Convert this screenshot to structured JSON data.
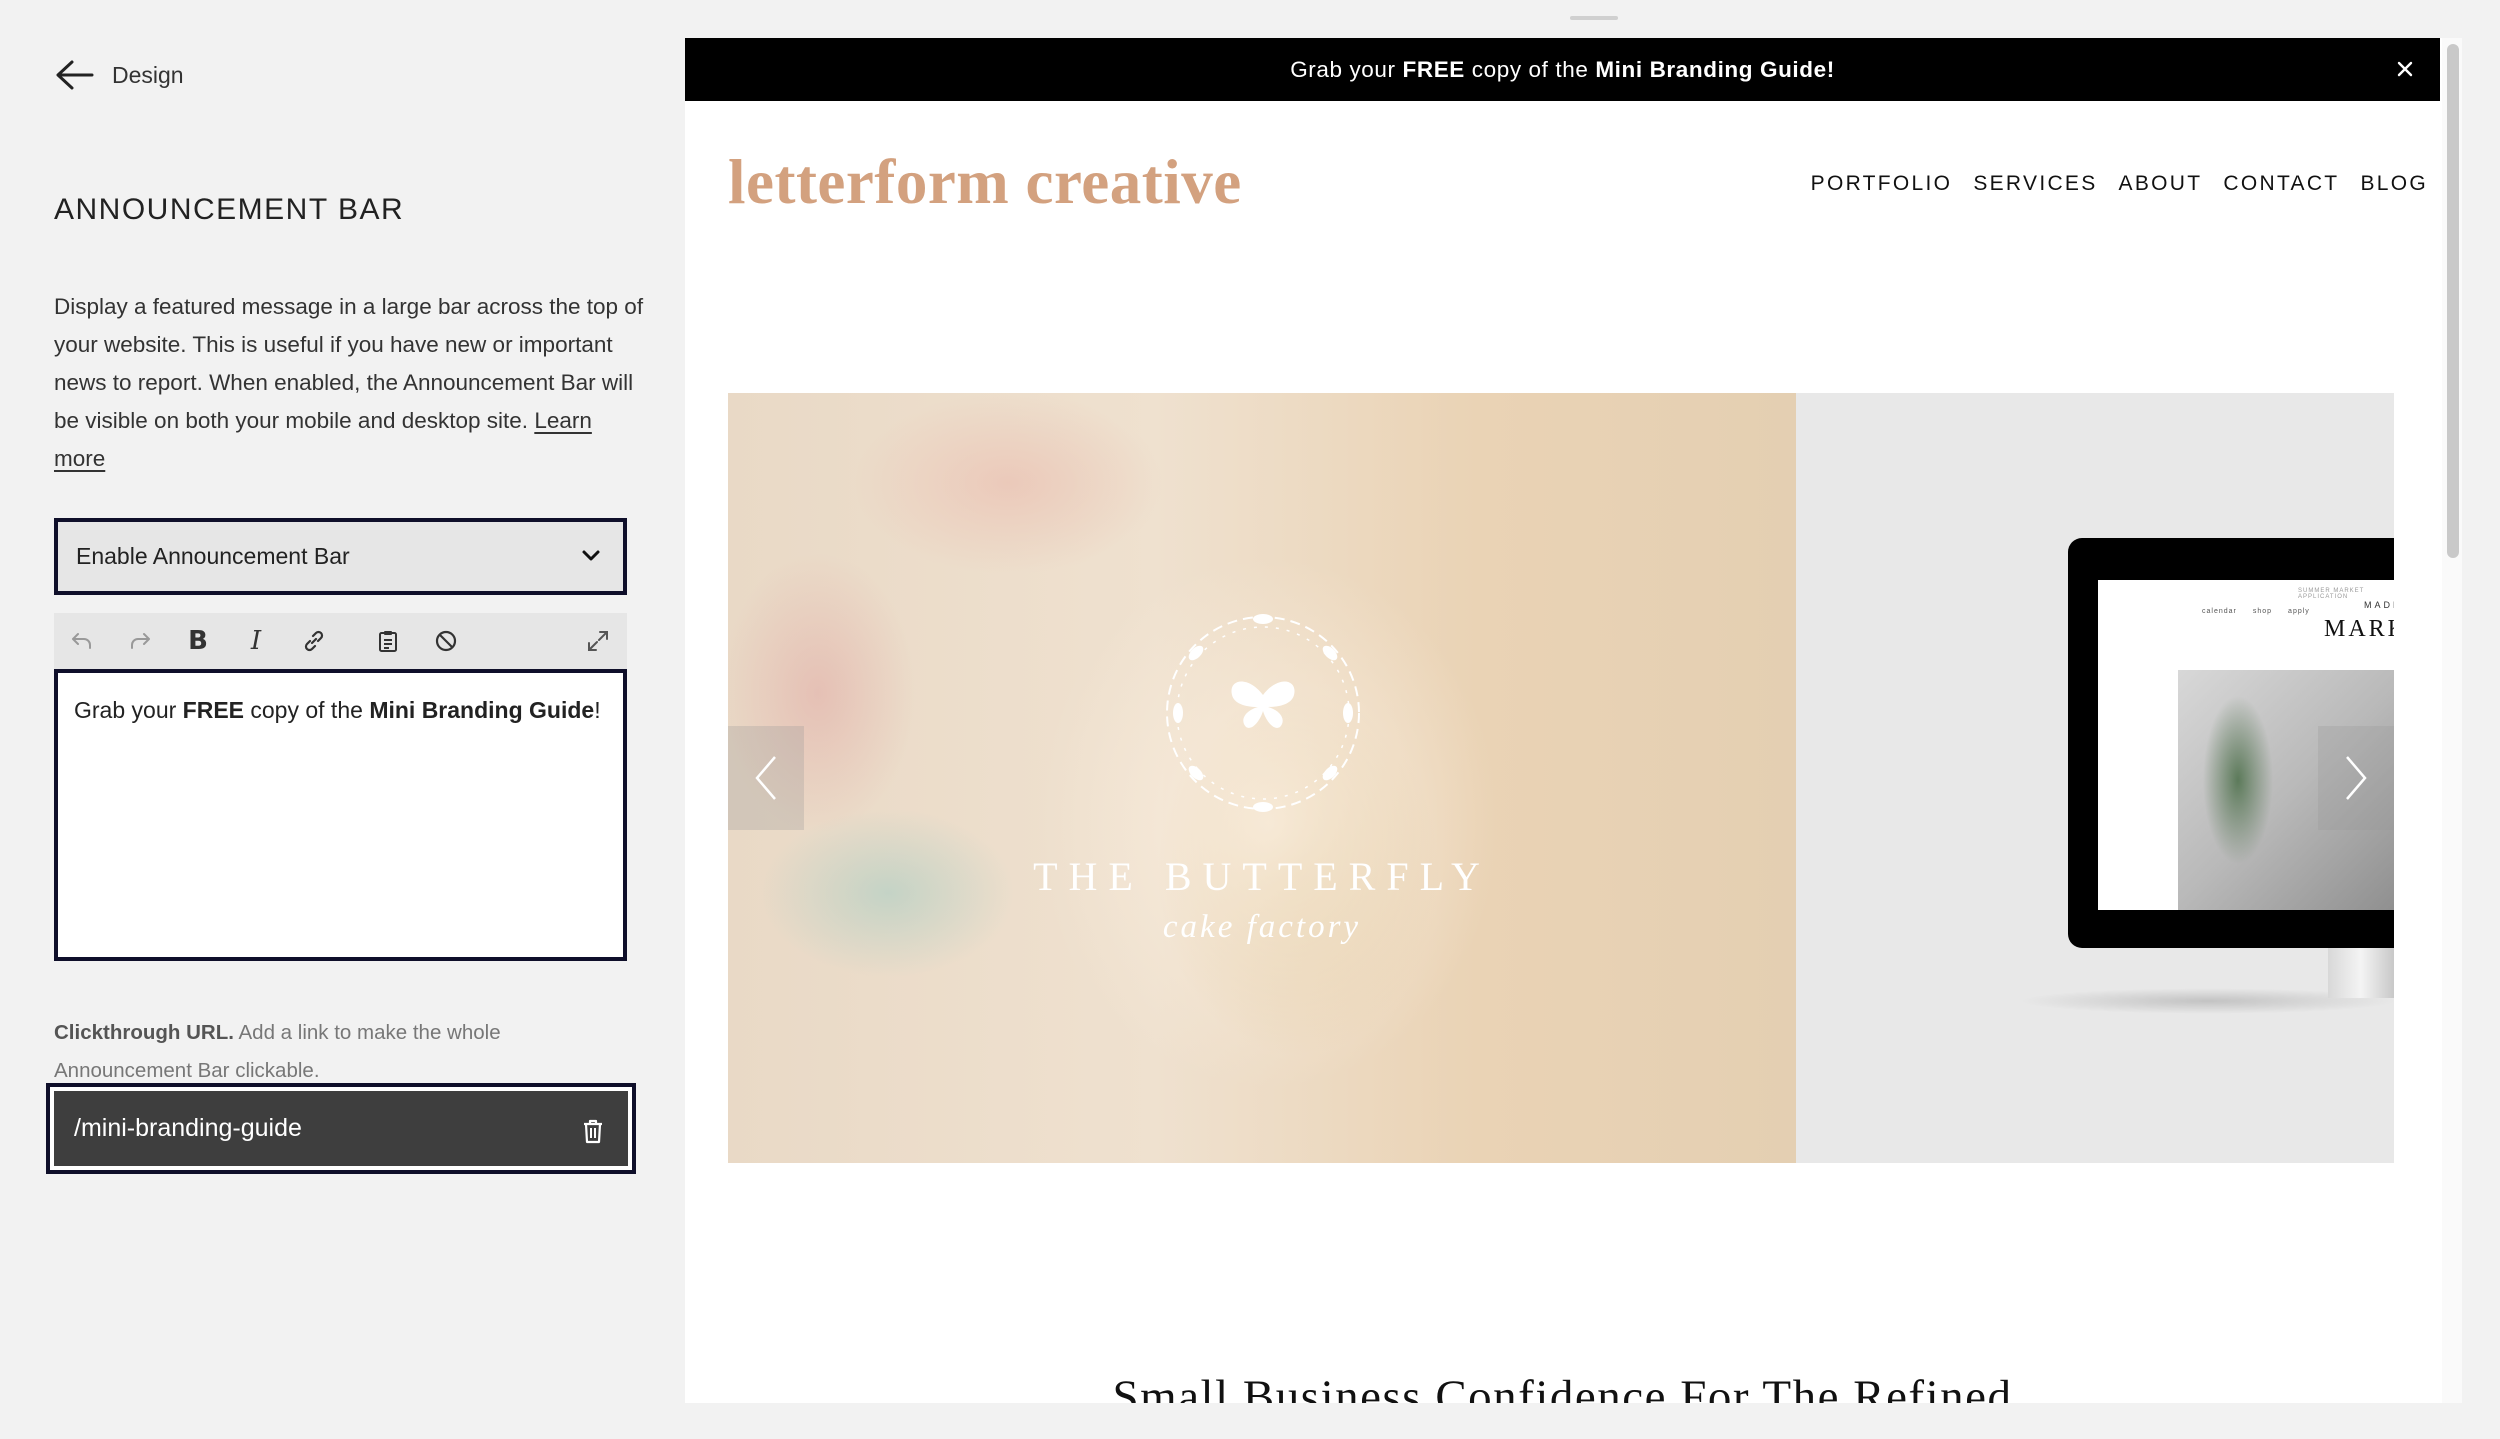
{
  "panel": {
    "back_label": "Design",
    "title": "ANNOUNCEMENT BAR",
    "description": "Display a featured message in a large bar across the top of your website. This is useful if you have new or important news to report. When enabled, the Announcement Bar will be visible on both your mobile and desktop site.",
    "learn_more": "Learn more",
    "select_value": "Enable Announcement Bar",
    "editor": {
      "t1": "Grab your ",
      "b1": "FREE",
      "t2": " copy of the ",
      "b2": "Mini Branding Guide",
      "t3": "!"
    },
    "clickthrough_label": "Clickthrough URL.",
    "clickthrough_help": " Add a link to make the whole Announcement Bar clickable.",
    "url_value": "/mini-branding-guide"
  },
  "toolbar": {
    "icons": [
      "undo-icon",
      "redo-icon",
      "bold-icon",
      "italic-icon",
      "link-icon",
      "paste-text-icon",
      "clear-format-icon",
      "expand-icon"
    ],
    "bold_glyph": "B",
    "italic_glyph": "I"
  },
  "preview": {
    "announcement": {
      "t1": "Grab your ",
      "b1": "FREE",
      "t2": " copy of the ",
      "b2": "Mini Branding Guide!"
    },
    "logo": "letterform creative",
    "nav": [
      "PORTFOLIO",
      "SERVICES",
      "ABOUT",
      "CONTACT",
      "BLOG"
    ],
    "slide": {
      "brand_line1": "THE BUTTERFLY",
      "brand_line2": "cake factory"
    },
    "mockup": {
      "top_line": "SUMMER MARKET APPLICATION",
      "nav": [
        "calendar",
        "shop",
        "apply"
      ],
      "made": "MADE",
      "mark": "MARK"
    },
    "headline": "Small Business Confidence For The Refined"
  },
  "colors": {
    "logo": "#d3a17f",
    "focus_border": "#0f0f2a",
    "announcement_bg": "#000000",
    "url_field_bg": "#3e3e3e"
  }
}
